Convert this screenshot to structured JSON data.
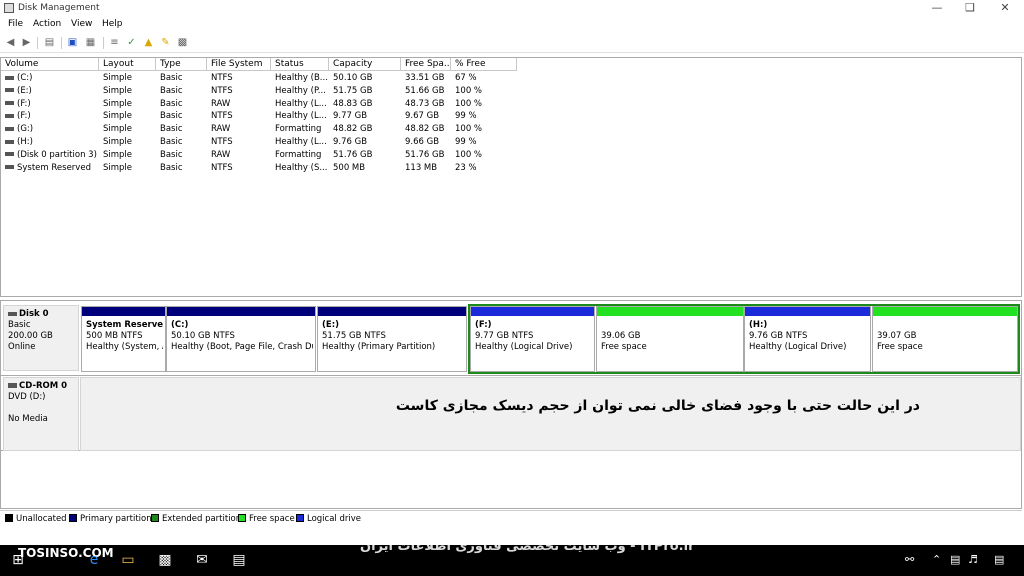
{
  "window": {
    "title": "Disk Management"
  },
  "menu": [
    "File",
    "Action",
    "View",
    "Help"
  ],
  "toolbar_icons": [
    "back-arrow-icon",
    "forward-arrow-icon",
    "console-tree-icon",
    "help-icon",
    "properties-icon",
    "connect-icon",
    "check-icon",
    "new-icon",
    "export-icon",
    "view-icon"
  ],
  "table": {
    "columns": [
      "Volume",
      "Layout",
      "Type",
      "File System",
      "Status",
      "Capacity",
      "Free Spa...",
      "% Free"
    ],
    "rows": [
      [
        "(C:)",
        "Simple",
        "Basic",
        "NTFS",
        "Healthy (B...",
        "50.10 GB",
        "33.51 GB",
        "67 %"
      ],
      [
        "(E:)",
        "Simple",
        "Basic",
        "NTFS",
        "Healthy (P...",
        "51.75 GB",
        "51.66 GB",
        "100 %"
      ],
      [
        "(F:)",
        "Simple",
        "Basic",
        "RAW",
        "Healthy (L...",
        "48.83 GB",
        "48.73 GB",
        "100 %"
      ],
      [
        "(F:)",
        "Simple",
        "Basic",
        "NTFS",
        "Healthy (L...",
        "9.77 GB",
        "9.67 GB",
        "99 %"
      ],
      [
        "(G:)",
        "Simple",
        "Basic",
        "RAW",
        "Formatting",
        "48.82 GB",
        "48.82 GB",
        "100 %"
      ],
      [
        "(H:)",
        "Simple",
        "Basic",
        "NTFS",
        "Healthy (L...",
        "9.76 GB",
        "9.66 GB",
        "99 %"
      ],
      [
        "(Disk 0 partition 3)",
        "Simple",
        "Basic",
        "RAW",
        "Formatting",
        "51.76 GB",
        "51.76 GB",
        "100 %"
      ],
      [
        "System Reserved",
        "Simple",
        "Basic",
        "NTFS",
        "Healthy (S...",
        "500 MB",
        "113 MB",
        "23 %"
      ]
    ]
  },
  "disk0": {
    "name": "Disk 0",
    "type": "Basic",
    "size": "200.00 GB",
    "status": "Online",
    "partitions": [
      {
        "title": "System Reserved",
        "line1": "500 MB NTFS",
        "line2": "Healthy (System, A",
        "kind": "primary"
      },
      {
        "title": "(C:)",
        "line1": "50.10 GB NTFS",
        "line2": "Healthy (Boot, Page File, Crash Dur",
        "kind": "primary"
      },
      {
        "title": "(E:)",
        "line1": "51.75 GB NTFS",
        "line2": "Healthy (Primary Partition)",
        "kind": "primary"
      },
      {
        "title": "(F:)",
        "line1": "9.77 GB NTFS",
        "line2": "Healthy (Logical Drive)",
        "kind": "logical"
      },
      {
        "title": "",
        "line1": "39.06 GB",
        "line2": "Free space",
        "kind": "free"
      },
      {
        "title": "(H:)",
        "line1": "9.76 GB NTFS",
        "line2": "Healthy (Logical Drive)",
        "kind": "logical"
      },
      {
        "title": "",
        "line1": "39.07 GB",
        "line2": "Free space",
        "kind": "free"
      }
    ]
  },
  "cdrom": {
    "name": "CD-ROM 0",
    "drive": "DVD (D:)",
    "status": "No Media"
  },
  "note": "در این حالت حتی با وجود فضای خالی نمی توان از حجم دیسک مجازی کاست",
  "legend": [
    {
      "label": "Unallocated",
      "color": "#000000"
    },
    {
      "label": "Primary partition",
      "color": "#00007b"
    },
    {
      "label": "Extended partition",
      "color": "#1b8a1b"
    },
    {
      "label": "Free space",
      "color": "#22e022"
    },
    {
      "label": "Logical drive",
      "color": "#1c2bd9"
    }
  ],
  "colors": {
    "primary": "#00007b",
    "logical": "#1c2bd9",
    "free": "#22e022",
    "extended": "#1b8a1b"
  },
  "taskbar": {
    "watermark_left": "TOSINSO.COM",
    "watermark_center": "ITPro.ir - وب سایت تخصصی فناوری اطلاعات ایران"
  }
}
